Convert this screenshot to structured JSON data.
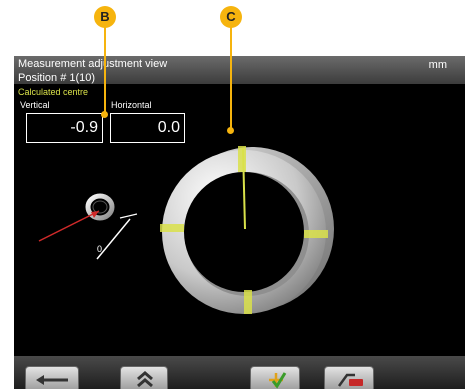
{
  "header": {
    "title": "Measurement adjustment view",
    "position": "Position # 1(10)",
    "unit": "mm"
  },
  "centre": {
    "label": "Calculated centre",
    "vertical_label": "Vertical",
    "horizontal_label": "Horizontal",
    "vertical_value": "-0.9",
    "horizontal_value": "0.0"
  },
  "indicator": {
    "zero_label": "0"
  },
  "callouts": {
    "b": "B",
    "c": "C"
  },
  "colors": {
    "accent": "#f6b40e",
    "marker": "#d9e14a",
    "screen": "#000000"
  },
  "icons": [
    "back-arrow-icon",
    "chevron-up-icon",
    "move-confirm-icon",
    "eraser-icon"
  ]
}
